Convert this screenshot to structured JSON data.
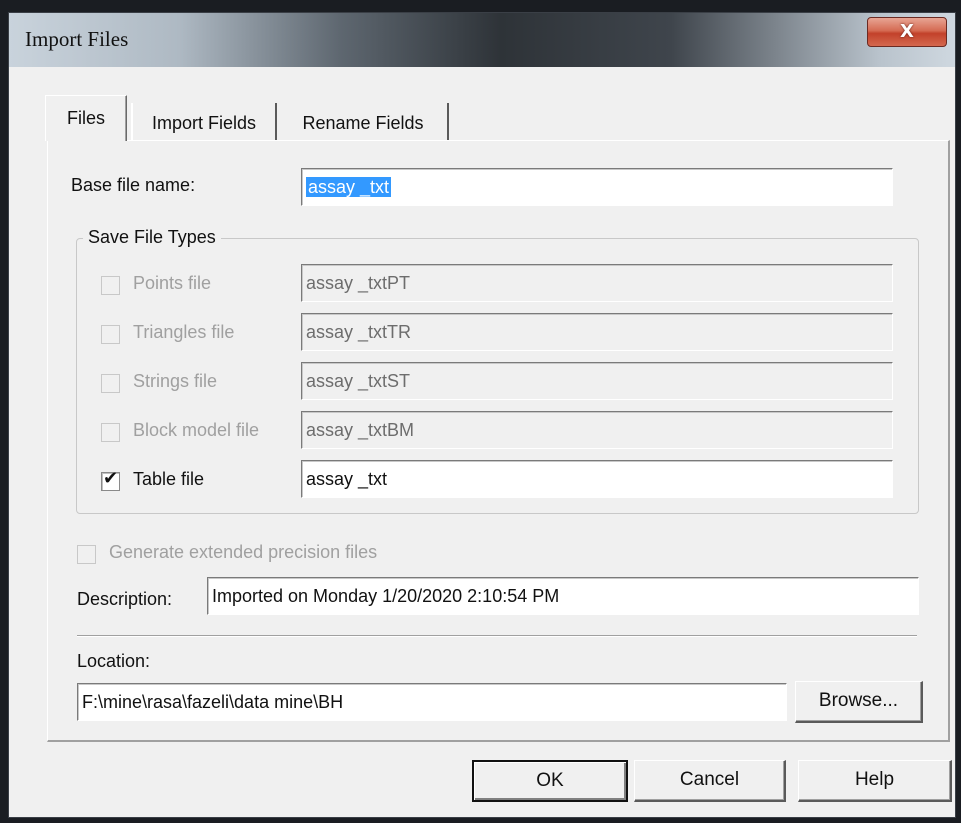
{
  "window": {
    "title": "Import Files",
    "close_glyph": "X"
  },
  "tabs": [
    {
      "label": "Files",
      "active": true
    },
    {
      "label": "Import Fields",
      "active": false
    },
    {
      "label": "Rename Fields",
      "active": false
    }
  ],
  "files_tab": {
    "base_file_name": {
      "label": "Base file name:",
      "value": "assay _txt",
      "selected": true
    },
    "save_file_types": {
      "title": "Save File Types",
      "rows": [
        {
          "label": "Points file",
          "value": "assay _txtPT",
          "checked": false,
          "enabled": false
        },
        {
          "label": "Triangles file",
          "value": "assay _txtTR",
          "checked": false,
          "enabled": false
        },
        {
          "label": "Strings file",
          "value": "assay _txtST",
          "checked": false,
          "enabled": false
        },
        {
          "label": "Block model file",
          "value": "assay _txtBM",
          "checked": false,
          "enabled": false
        },
        {
          "label": "Table file",
          "value": "assay _txt",
          "checked": true,
          "enabled": true
        }
      ]
    },
    "extended_precision": {
      "label": "Generate extended precision files",
      "checked": false,
      "enabled": false
    },
    "description": {
      "label": "Description:",
      "value": "Imported on Monday 1/20/2020 2:10:54 PM"
    },
    "location": {
      "label": "Location:",
      "value": "F:\\mine\\rasa\\fazeli\\data mine\\BH",
      "browse_label": "Browse..."
    }
  },
  "buttons": {
    "ok": "OK",
    "cancel": "Cancel",
    "help": "Help"
  },
  "icons": {
    "checkmark": "checkmark-icon"
  },
  "colors": {
    "selection": "#3399ff",
    "close_button": "#c2412a",
    "dialog_bg": "#f0f0f0"
  }
}
